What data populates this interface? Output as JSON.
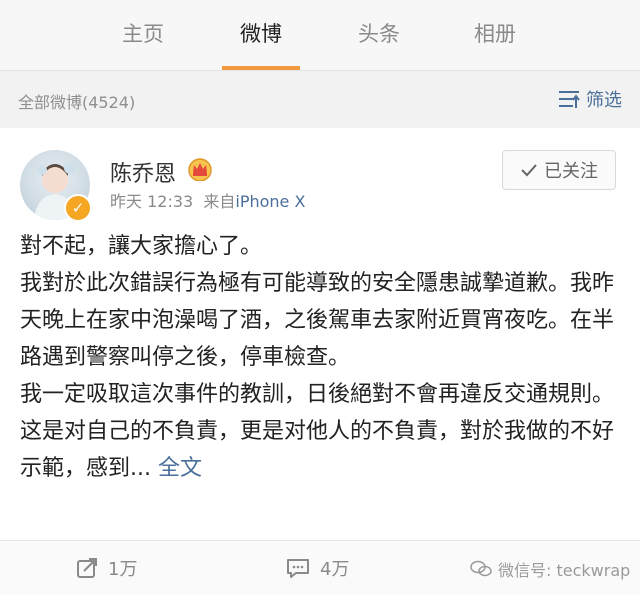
{
  "tabs": [
    {
      "label": "主页",
      "active": false
    },
    {
      "label": "微博",
      "active": true
    },
    {
      "label": "头条",
      "active": false
    },
    {
      "label": "相册",
      "active": false
    }
  ],
  "filterbar": {
    "count_label": "全部微博(4524)",
    "filter_label": "筛选"
  },
  "post": {
    "username": "陈乔恩",
    "time": "昨天 12:33",
    "source_prefix": "来自",
    "source": "iPhone X",
    "follow_label": "已关注",
    "paragraphs": [
      "對不起，讓大家擔心了。",
      "我對於此次錯誤行為極有可能導致的安全隱患誠摯道歉。我昨天晚上在家中泡澡喝了酒，之後駕車去家附近買宵夜吃。在半路遇到警察叫停之後，停車檢查。",
      "我一定吸取這次事件的教訓，日後絕對不會再違反交通規則。这是对自己的不負責，更是对他人的不負責，對於我做的不好示範，感到..."
    ],
    "more_label": "全文"
  },
  "actions": {
    "repost_count": "1万",
    "comment_count": "4万"
  },
  "watermark": "微信号: teckwrap",
  "colors": {
    "accent": "#f39a3e",
    "link": "#4a6f9a"
  }
}
